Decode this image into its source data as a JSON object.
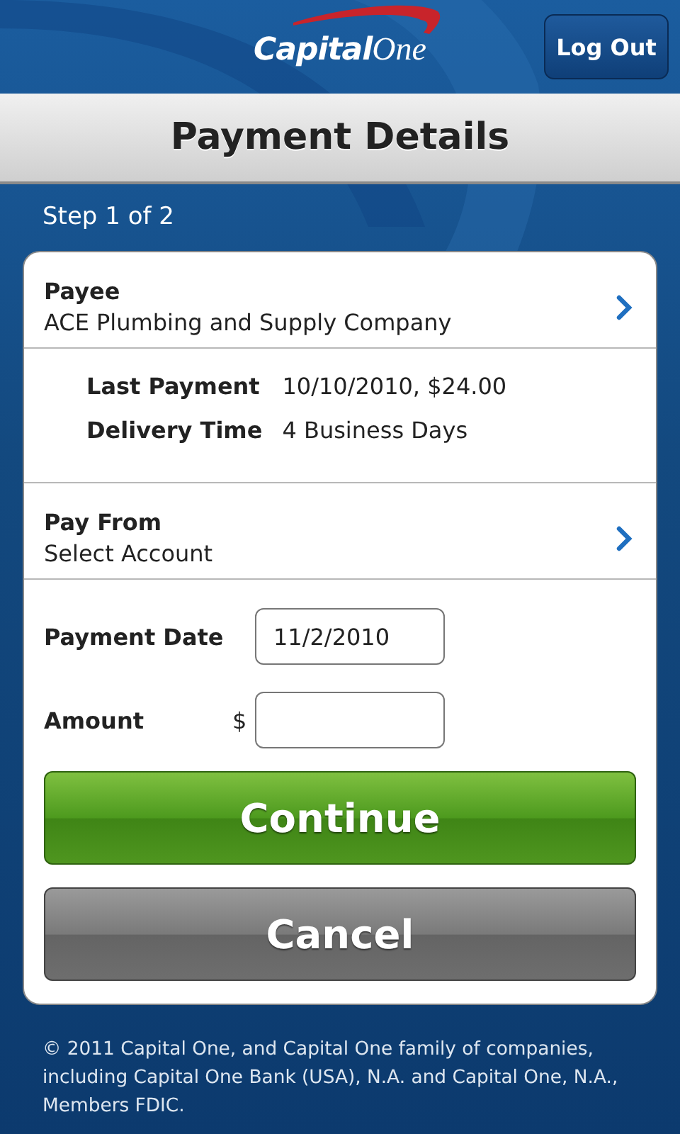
{
  "header": {
    "logo_words": [
      "Capital",
      "One"
    ],
    "logout_button": "Log Out"
  },
  "title": "Payment Details",
  "step": "Step 1 of 2",
  "payee": {
    "label": "Payee",
    "value": "ACE Plumbing and Supply Company"
  },
  "details": [
    {
      "label": "Last Payment",
      "value": "10/10/2010, $24.00"
    },
    {
      "label": "Delivery Time",
      "value": "4 Business Days"
    }
  ],
  "pay_from": {
    "label": "Pay From",
    "value": "Select Account"
  },
  "fields": [
    {
      "label": "Payment Date",
      "value": "11/2/2010"
    },
    {
      "label": "Amount",
      "prefix": "$"
    }
  ],
  "buttons": [
    {
      "label": "Continue",
      "kind": "primary"
    },
    {
      "label": "Cancel",
      "kind": "secondary"
    }
  ],
  "footer": "© 2011  Capital One, and Capital One family of companies, including Capital One Bank (USA), N.A. and Capital One, N.A., Members FDIC."
}
